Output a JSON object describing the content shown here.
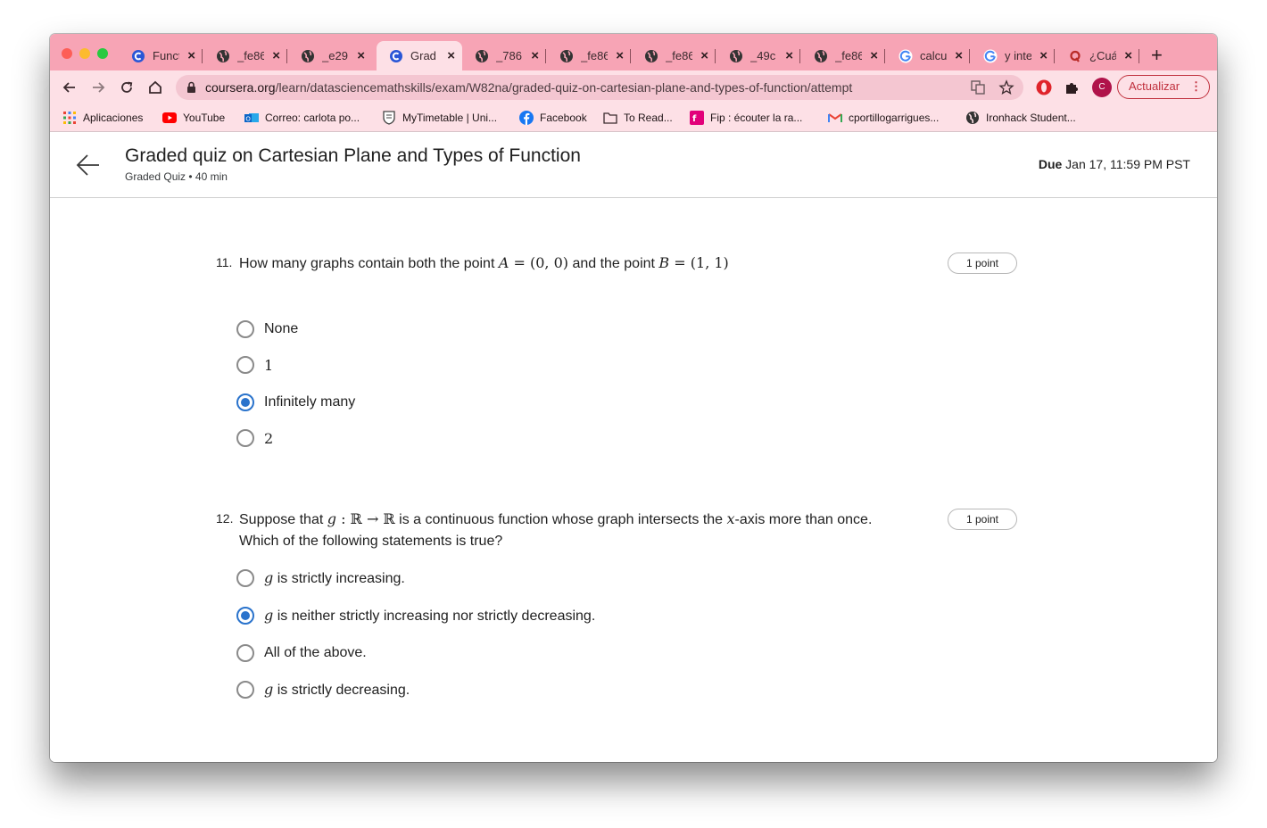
{
  "browser": {
    "tabs": [
      {
        "title": "Funct",
        "icon": "coursera-icon",
        "active": false
      },
      {
        "title": "_fe86",
        "icon": "globe-icon",
        "active": false
      },
      {
        "title": "_e29",
        "icon": "globe-icon",
        "active": false
      },
      {
        "title": "Grad",
        "icon": "coursera-icon",
        "active": true
      },
      {
        "title": "_786",
        "icon": "globe-icon",
        "active": false
      },
      {
        "title": "_fe86",
        "icon": "globe-icon",
        "active": false
      },
      {
        "title": "_fe86",
        "icon": "globe-icon",
        "active": false
      },
      {
        "title": "_49c",
        "icon": "globe-icon",
        "active": false
      },
      {
        "title": "_fe86",
        "icon": "globe-icon",
        "active": false
      },
      {
        "title": "calcu",
        "icon": "google-icon",
        "active": false
      },
      {
        "title": "y inte",
        "icon": "google-icon",
        "active": false
      },
      {
        "title": "¿Cuá",
        "icon": "quora-icon",
        "active": false
      }
    ],
    "new_tab": "+",
    "url_domain": "coursera.org",
    "url_path": "/learn/datasciencemathskills/exam/W82na/graded-quiz-on-cartesian-plane-and-types-of-function/attempt",
    "avatar_letter": "C",
    "update_button": "Actualizar",
    "update_menu": "⋮",
    "bookmarks": [
      {
        "label": "Aplicaciones",
        "icon": "apps-grid-icon"
      },
      {
        "label": "YouTube",
        "icon": "youtube-icon"
      },
      {
        "label": "Correo: carlota po...",
        "icon": "outlook-icon"
      },
      {
        "label": "MyTimetable | Uni...",
        "icon": "shield-crest-icon"
      },
      {
        "label": "Facebook",
        "icon": "facebook-icon"
      },
      {
        "label": "To Read...",
        "icon": "folder-icon"
      },
      {
        "label": "Fip : écouter la ra...",
        "icon": "fip-icon"
      },
      {
        "label": "cportillogarrigues...",
        "icon": "gmail-icon"
      },
      {
        "label": "Ironhack Student...",
        "icon": "globe-icon"
      }
    ]
  },
  "header": {
    "title": "Graded quiz on Cartesian Plane and Types of Function",
    "subtitle": "Graded Quiz • 40 min",
    "due_label": "Due",
    "due_value": "Jan 17, 11:59 PM PST"
  },
  "questions": [
    {
      "number": "11.",
      "text_1": "How many graphs contain both the point ",
      "math_1": "A",
      "math_1b": " = (0, 0)",
      "text_2": " and the point ",
      "math_2": "B",
      "math_2b": " = (1, 1)",
      "points": "1 point",
      "options": [
        {
          "label": "None",
          "checked": false
        },
        {
          "label": "1",
          "checked": false
        },
        {
          "label": "Infinitely many",
          "checked": true
        },
        {
          "label": "2",
          "checked": false
        }
      ]
    },
    {
      "number": "12.",
      "text_1": "Suppose that ",
      "math_g": "g",
      "math_map": " : ℝ → ℝ",
      "text_2": " is a continuous function whose graph intersects the ",
      "math_x": "x",
      "text_3": "-axis more than once.",
      "text_line2": "Which of the following statements is true?",
      "points": "1 point",
      "options": [
        {
          "math": "g",
          "label": " is strictly increasing.",
          "checked": false
        },
        {
          "math": "g",
          "label": " is neither strictly increasing nor strictly decreasing.",
          "checked": true
        },
        {
          "math": "",
          "label": "All of the above.",
          "checked": false
        },
        {
          "math": "g",
          "label": " is strictly decreasing.",
          "checked": false
        }
      ]
    }
  ],
  "colors": {
    "tabstrip": "#f7a4b5",
    "toolbar": "#fde0e6",
    "radio_checked": "#2a73cc",
    "update_button": "#c0303d"
  }
}
